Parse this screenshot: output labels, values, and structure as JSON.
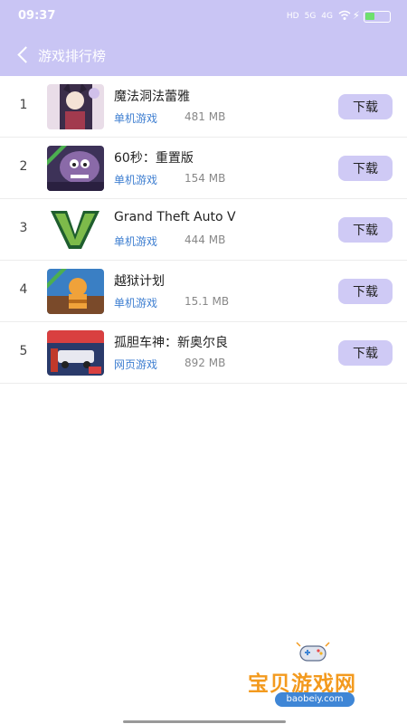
{
  "status_bar": {
    "time": "09:37",
    "icons": [
      "HD",
      "5G",
      "4G",
      "wifi"
    ],
    "battery_percent": 40
  },
  "header": {
    "title": "游戏排行榜",
    "bg_color": "#c9c5f4"
  },
  "games": [
    {
      "rank": "1",
      "name": "魔法洞法蕾雅",
      "category": "单机游戏",
      "size": "481 MB",
      "button": "下载"
    },
    {
      "rank": "2",
      "name": "60秒：重置版",
      "category": "单机游戏",
      "size": "154 MB",
      "button": "下载"
    },
    {
      "rank": "3",
      "name": "Grand Theft Auto V",
      "category": "单机游戏",
      "size": "444 MB",
      "button": "下载"
    },
    {
      "rank": "4",
      "name": "越狱计划",
      "category": "单机游戏",
      "size": "15.1 MB",
      "button": "下载"
    },
    {
      "rank": "5",
      "name": "孤胆车神：新奥尔良",
      "category": "网页游戏",
      "size": "892 MB",
      "button": "下载"
    }
  ],
  "watermark": {
    "cn": "宝贝游戏网",
    "en": "baobeiy.com"
  },
  "colors": {
    "category": "#3f7fd1",
    "button_bg": "#cfcaf5",
    "accent_orange": "#f39a1e"
  }
}
